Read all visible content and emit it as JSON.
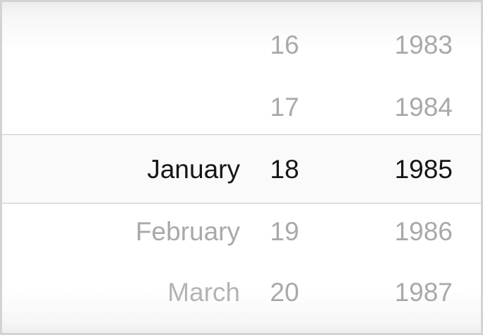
{
  "picker": {
    "months": [
      {
        "label": "January",
        "state": "selected"
      },
      {
        "label": "February",
        "state": "normal"
      },
      {
        "label": "March",
        "state": "normal"
      }
    ],
    "days": [
      {
        "label": "16",
        "state": "normal"
      },
      {
        "label": "17",
        "state": "normal"
      },
      {
        "label": "18",
        "state": "selected"
      },
      {
        "label": "19",
        "state": "normal"
      },
      {
        "label": "20",
        "state": "normal"
      }
    ],
    "years": [
      {
        "label": "1983",
        "state": "normal"
      },
      {
        "label": "1984",
        "state": "normal"
      },
      {
        "label": "1985",
        "state": "selected"
      },
      {
        "label": "1986",
        "state": "normal"
      },
      {
        "label": "1987",
        "state": "normal"
      }
    ],
    "colors": {
      "selected_text": "#161616",
      "unselected_text": "#a9a9a9",
      "divider": "#c8c8c8",
      "border": "#d3d3d3"
    }
  }
}
